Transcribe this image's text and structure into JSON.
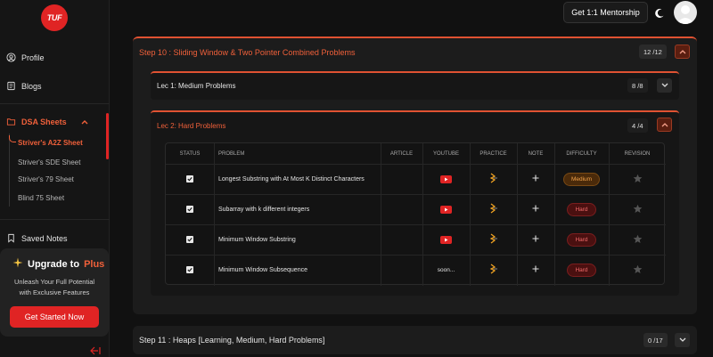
{
  "logo": {
    "text": "TUF"
  },
  "sidebar": {
    "profile": "Profile",
    "blogs": "Blogs",
    "dsa_sheets": "DSA Sheets",
    "sheets": [
      "Striver's A2Z Sheet",
      "Striver's SDE Sheet",
      "Striver's 79 Sheet",
      "Blind 75 Sheet"
    ],
    "saved_notes": "Saved Notes"
  },
  "upgrade": {
    "title": "Upgrade to",
    "plus": "Plus",
    "desc_line1": "Unleash Your Full Potential",
    "desc_line2": "with Exclusive Features",
    "cta": "Get Started Now"
  },
  "header": {
    "mentorship": "Get 1:1 Mentorship"
  },
  "step10": {
    "title": "Step 10 : Sliding Window & Two Pointer Combined Problems",
    "count": "12 /12"
  },
  "lec1": {
    "title": "Lec 1: Medium Problems",
    "count": "8 /8"
  },
  "lec2": {
    "title": "Lec 2: Hard Problems",
    "count": "4 /4"
  },
  "table": {
    "headers": {
      "status": "Status",
      "problem": "Problem",
      "article": "Article",
      "youtube": "Youtube",
      "practice": "Practice",
      "note": "Note",
      "difficulty": "Difficulty",
      "revision": "Revision"
    },
    "rows": [
      {
        "problem": "Longest Substring with At Most K Distinct Characters",
        "youtube": "icon",
        "difficulty": "Medium",
        "level": "medium"
      },
      {
        "problem": "Subarray with k different integers",
        "youtube": "icon",
        "difficulty": "Hard",
        "level": "hard"
      },
      {
        "problem": "Minimum Window Substring",
        "youtube": "icon",
        "difficulty": "Hard",
        "level": "hard"
      },
      {
        "problem": "Minimum Window Subsequence",
        "youtube": "soon...",
        "difficulty": "Hard",
        "level": "hard"
      }
    ]
  },
  "step11": {
    "title": "Step 11 : Heaps [Learning, Medium, Hard Problems]",
    "count": "0 /17"
  },
  "colors": {
    "accent": "#e05232",
    "brand_red": "#e02424",
    "medium": "#f0a24a",
    "hard": "#f06a6a"
  }
}
